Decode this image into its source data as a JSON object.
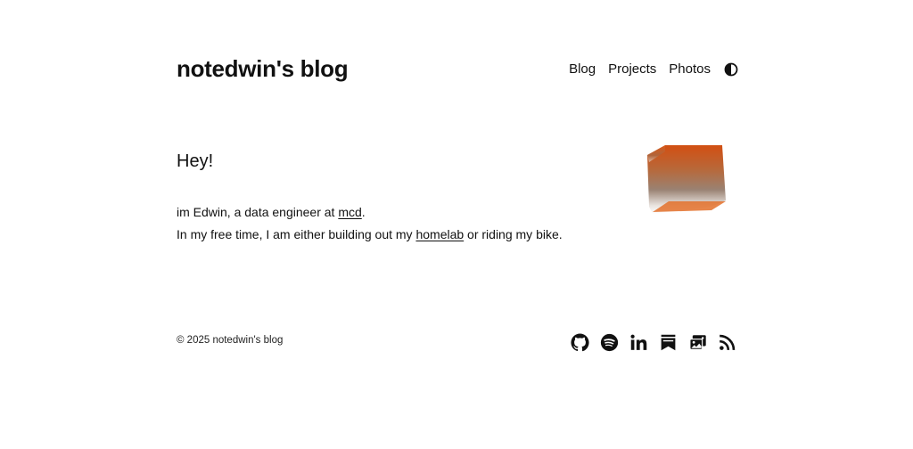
{
  "header": {
    "site_title": "notedwin's blog",
    "nav": [
      {
        "label": "Blog"
      },
      {
        "label": "Projects"
      },
      {
        "label": "Photos"
      }
    ],
    "theme_toggle_icon": "contrast-half-circle-icon"
  },
  "main": {
    "greeting": "Hey!",
    "intro_line1_prefix": "im Edwin, a data engineer at ",
    "intro_line1_link": "mcd",
    "intro_line1_suffix": ".",
    "intro_line2_prefix": "In my free time, I am either building out my ",
    "intro_line2_link": "homelab",
    "intro_line2_suffix": " or riding my bike.",
    "cube_colors": {
      "top": "#d5571a",
      "bottom": "#ffffff",
      "edge": "#e8772e"
    }
  },
  "footer": {
    "copyright": "© 2025 notedwin's blog",
    "social_icons": [
      "github-icon",
      "spotify-icon",
      "linkedin-icon",
      "bookmarks-icon",
      "photos-icon",
      "rss-icon"
    ]
  }
}
